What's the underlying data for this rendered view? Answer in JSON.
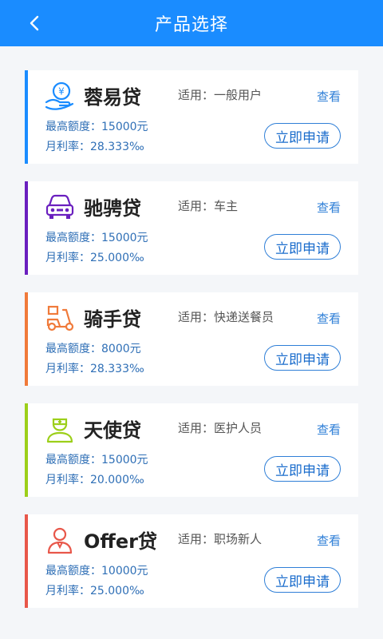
{
  "header": {
    "title": "产品选择"
  },
  "products": [
    {
      "name": "蓉易贷",
      "suitable": "适用：一般用户",
      "view": "查看",
      "max_amount": "最高额度：15000元",
      "monthly_rate": "月利率：28.333‰",
      "apply": "立即申请",
      "icon": "hand-yen-icon",
      "accent": "#1a8cff"
    },
    {
      "name": "驰骋贷",
      "suitable": "适用：车主",
      "view": "查看",
      "max_amount": "最高额度：15000元",
      "monthly_rate": "月利率：25.000‰",
      "apply": "立即申请",
      "icon": "car-icon",
      "accent": "#6a1fbf"
    },
    {
      "name": "骑手贷",
      "suitable": "适用：快递送餐员",
      "view": "查看",
      "max_amount": "最高额度：8000元",
      "monthly_rate": "月利率：28.333‰",
      "apply": "立即申请",
      "icon": "scooter-icon",
      "accent": "#f07a3a"
    },
    {
      "name": "天使贷",
      "suitable": "适用：医护人员",
      "view": "查看",
      "max_amount": "最高额度：15000元",
      "monthly_rate": "月利率：20.000‰",
      "apply": "立即申请",
      "icon": "nurse-icon",
      "accent": "#9ccf1a"
    },
    {
      "name": "Offer贷",
      "suitable": "适用：职场新人",
      "view": "查看",
      "max_amount": "最高额度：10000元",
      "monthly_rate": "月利率：25.000‰",
      "apply": "立即申请",
      "icon": "person-icon",
      "accent": "#e8574a"
    }
  ]
}
